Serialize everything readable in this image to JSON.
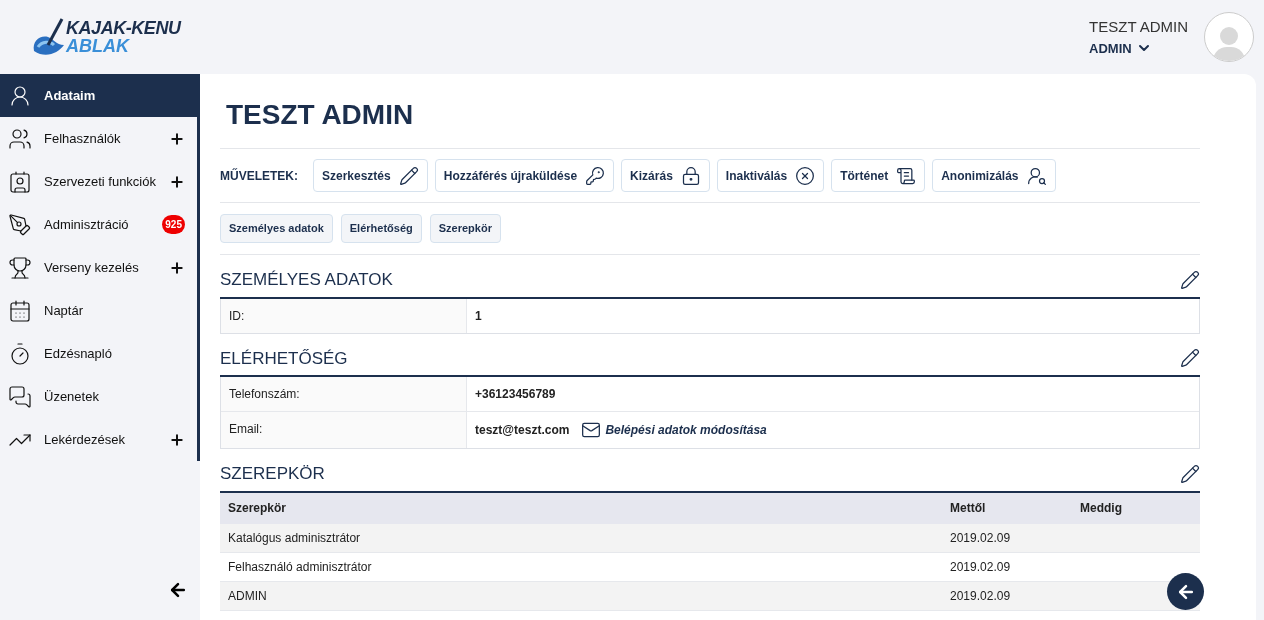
{
  "logo": {
    "line1": "KAJAK-KENU",
    "line2": "ABLAK"
  },
  "user": {
    "name": "TESZT ADMIN",
    "role": "ADMIN"
  },
  "sidebar": {
    "items": [
      {
        "label": "Adataim",
        "selected": true,
        "expandable": false
      },
      {
        "label": "Felhasználók",
        "selected": false,
        "expandable": true
      },
      {
        "label": "Szervezeti funkciók",
        "selected": false,
        "expandable": true
      },
      {
        "label": "Adminisztráció",
        "selected": false,
        "expandable": false,
        "badge": "925"
      },
      {
        "label": "Verseny kezelés",
        "selected": false,
        "expandable": true
      },
      {
        "label": "Naptár",
        "selected": false,
        "expandable": false
      },
      {
        "label": "Edzésnapló",
        "selected": false,
        "expandable": false
      },
      {
        "label": "Üzenetek",
        "selected": false,
        "expandable": false
      },
      {
        "label": "Lekérdezések",
        "selected": false,
        "expandable": true
      }
    ]
  },
  "page_title": "TESZT ADMIN",
  "actions": {
    "label": "MŰVELETEK:",
    "buttons": [
      "Szerkesztés",
      "Hozzáférés újraküldése",
      "Kizárás",
      "Inaktiválás",
      "Történet",
      "Anonimizálás"
    ]
  },
  "section_tabs": [
    "Személyes adatok",
    "Elérhetőség",
    "Szerepkör"
  ],
  "personal": {
    "title": "SZEMÉLYES ADATOK",
    "rows": [
      {
        "label": "ID:",
        "value": "1"
      }
    ]
  },
  "contact": {
    "title": "ELÉRHETŐSÉG",
    "rows": [
      {
        "label": "Telefonszám:",
        "value": "+36123456789"
      },
      {
        "label": "Email:",
        "value": "teszt@teszt.com",
        "link": "Belépési adatok módosítása"
      }
    ]
  },
  "roles": {
    "title": "SZEREPKÖR",
    "columns": [
      "Szerepkör",
      "Mettől",
      "Meddig"
    ],
    "rows": [
      [
        "Katalógus adminisztrátor",
        "2019.02.09",
        ""
      ],
      [
        "Felhasználó adminisztrátor",
        "2019.02.09",
        ""
      ],
      [
        "ADMIN",
        "2019.02.09",
        ""
      ]
    ]
  }
}
